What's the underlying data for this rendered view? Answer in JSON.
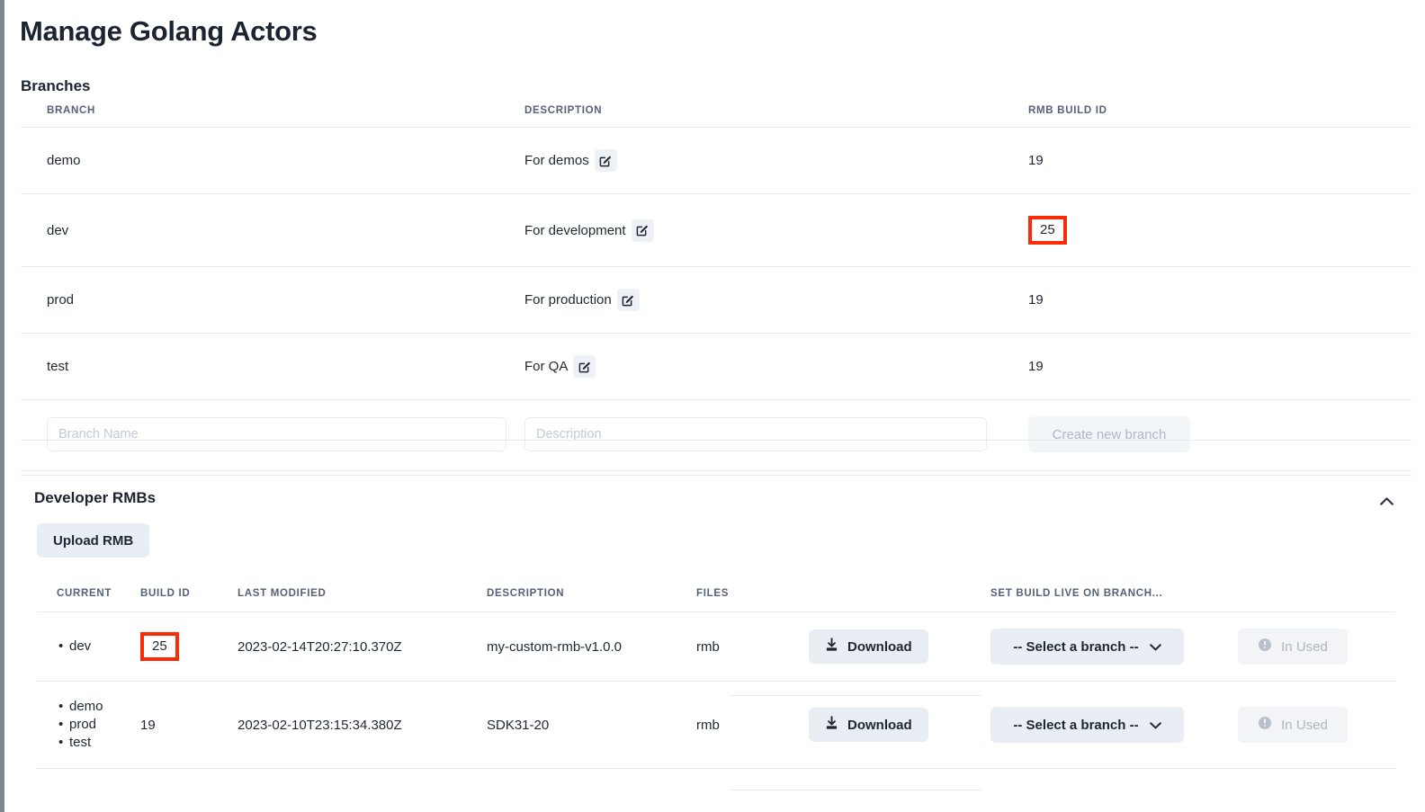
{
  "page": {
    "title": "Manage Golang Actors"
  },
  "branches_section": {
    "heading": "Branches",
    "columns": [
      "BRANCH",
      "DESCRIPTION",
      "RMB BUILD ID"
    ],
    "rows": [
      {
        "branch": "demo",
        "description": "For demos",
        "build_id": "19",
        "edit_icon": "edit-square-icon",
        "highlighted": false
      },
      {
        "branch": "dev",
        "description": "For development",
        "build_id": "25",
        "edit_icon": "edit-square-icon",
        "highlighted": true
      },
      {
        "branch": "prod",
        "description": "For production",
        "build_id": "19",
        "edit_icon": "edit-square-icon",
        "highlighted": false
      },
      {
        "branch": "test",
        "description": "For QA",
        "build_id": "19",
        "edit_icon": "edit-square-icon",
        "highlighted": false
      }
    ],
    "new_branch": {
      "name_placeholder": "Branch Name",
      "name_value": "",
      "description_placeholder": "Description",
      "description_value": "",
      "create_label": "Create new branch"
    }
  },
  "rmb_section": {
    "heading": "Developer RMBs",
    "collapse_icon": "chevron-up-icon",
    "upload_label": "Upload RMB",
    "columns": [
      "CURRENT",
      "BUILD ID",
      "LAST MODIFIED",
      "DESCRIPTION",
      "FILES",
      "",
      "SET BUILD LIVE ON BRANCH...",
      ""
    ],
    "rows": [
      {
        "current": [
          "dev"
        ],
        "build_id": "25",
        "highlighted": true,
        "last_modified": "2023-02-14T20:27:10.370Z",
        "description": "my-custom-rmb-v1.0.0",
        "files": "rmb",
        "download_label": "Download",
        "download_icon": "download-icon",
        "select_label": "-- Select a branch --",
        "select_icon": "chevron-down-icon",
        "status_label": "In Used",
        "status_icon": "exclamation-circle-icon"
      },
      {
        "current": [
          "demo",
          "prod",
          "test"
        ],
        "build_id": "19",
        "highlighted": false,
        "last_modified": "2023-02-10T23:15:34.380Z",
        "description": "SDK31-20",
        "files": "rmb",
        "download_label": "Download",
        "download_icon": "download-icon",
        "select_label": "-- Select a branch --",
        "select_icon": "chevron-down-icon",
        "status_label": "In Used",
        "status_icon": "exclamation-circle-icon"
      }
    ]
  },
  "colors": {
    "highlight_red": "#fb2b06",
    "button_bg": "#e9eef4",
    "disabled_text": "#aeb6c4",
    "text": "#1f2733",
    "header_text": "#55607a",
    "divider": "#e7ebf0",
    "left_rail": "#808590"
  }
}
